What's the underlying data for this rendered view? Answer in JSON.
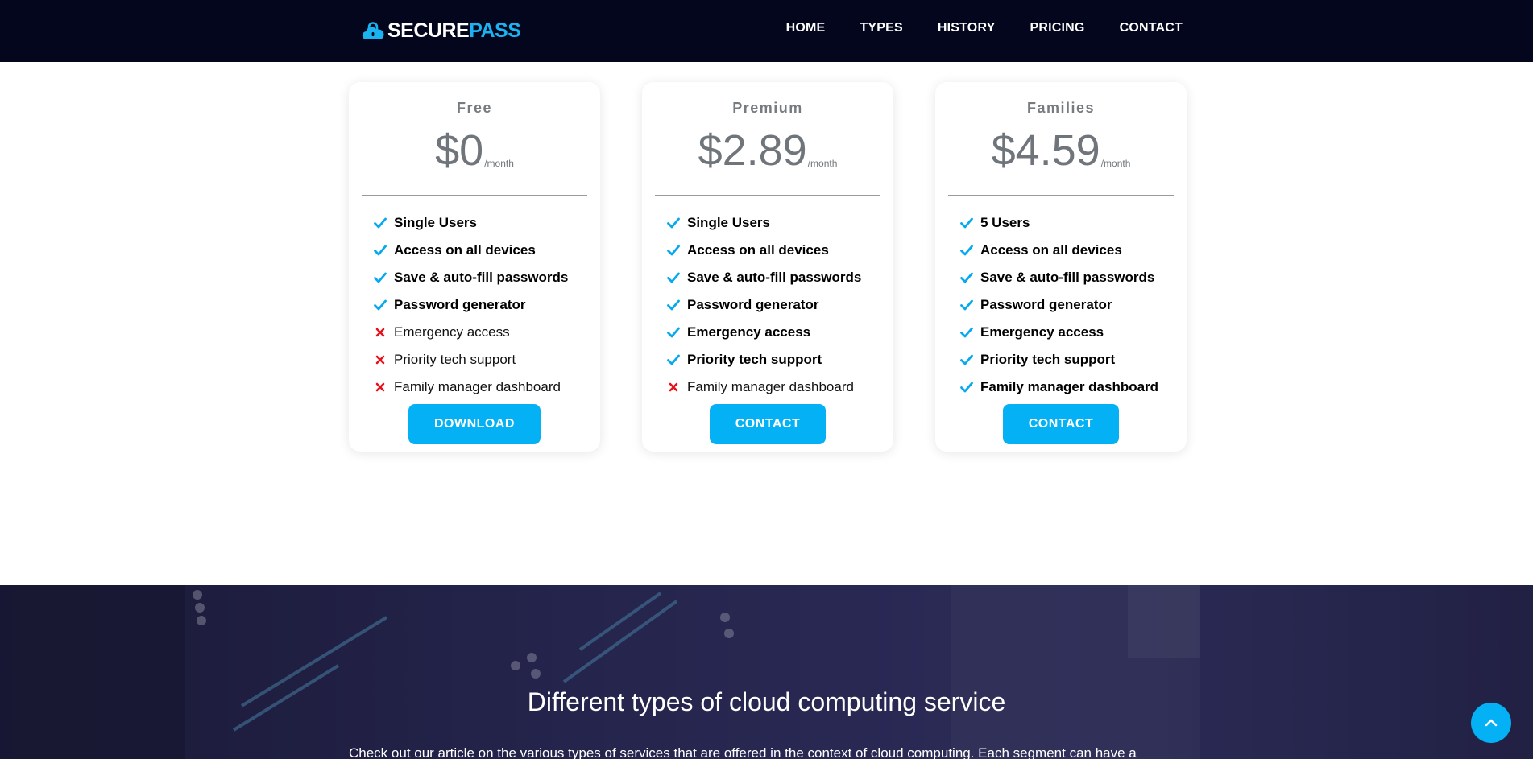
{
  "brand": {
    "part1": "SECURE",
    "part2": "PASS",
    "icon": "cloud-lock-icon"
  },
  "nav": [
    "HOME",
    "TYPES",
    "HISTORY",
    "PRICING",
    "CONTACT"
  ],
  "plans": [
    {
      "name": "Free",
      "price": "$0",
      "unit": "/month",
      "features": [
        {
          "label": "Single Users",
          "included": true
        },
        {
          "label": "Access on all devices",
          "included": true
        },
        {
          "label": "Save & auto-fill passwords",
          "included": true
        },
        {
          "label": "Password generator",
          "included": true
        },
        {
          "label": "Emergency access",
          "included": false
        },
        {
          "label": "Priority tech support",
          "included": false
        },
        {
          "label": "Family manager dashboard",
          "included": false
        }
      ],
      "button": "DOWNLOAD"
    },
    {
      "name": "Premium",
      "price": "$2.89",
      "unit": "/month",
      "features": [
        {
          "label": "Single Users",
          "included": true
        },
        {
          "label": "Access on all devices",
          "included": true
        },
        {
          "label": "Save & auto-fill passwords",
          "included": true
        },
        {
          "label": "Password generator",
          "included": true
        },
        {
          "label": "Emergency access",
          "included": true
        },
        {
          "label": "Priority tech support",
          "included": true
        },
        {
          "label": "Family manager dashboard",
          "included": false
        }
      ],
      "button": "CONTACT"
    },
    {
      "name": "Families",
      "price": "$4.59",
      "unit": "/month",
      "features": [
        {
          "label": "5 Users",
          "included": true
        },
        {
          "label": "Access on all devices",
          "included": true
        },
        {
          "label": "Save & auto-fill passwords",
          "included": true
        },
        {
          "label": "Password generator",
          "included": true
        },
        {
          "label": "Emergency access",
          "included": true
        },
        {
          "label": "Priority tech support",
          "included": true
        },
        {
          "label": "Family manager dashboard",
          "included": true
        }
      ],
      "button": "CONTACT"
    }
  ],
  "section": {
    "title": "Different types of cloud computing service",
    "text": "Check out our article on the various types of services that are offered in the context of cloud computing. Each segment can have a"
  },
  "colors": {
    "accent": "#05b1f5",
    "nav_bg": "#03061c",
    "check": "#05a9ef",
    "cross": "#e8101b"
  }
}
